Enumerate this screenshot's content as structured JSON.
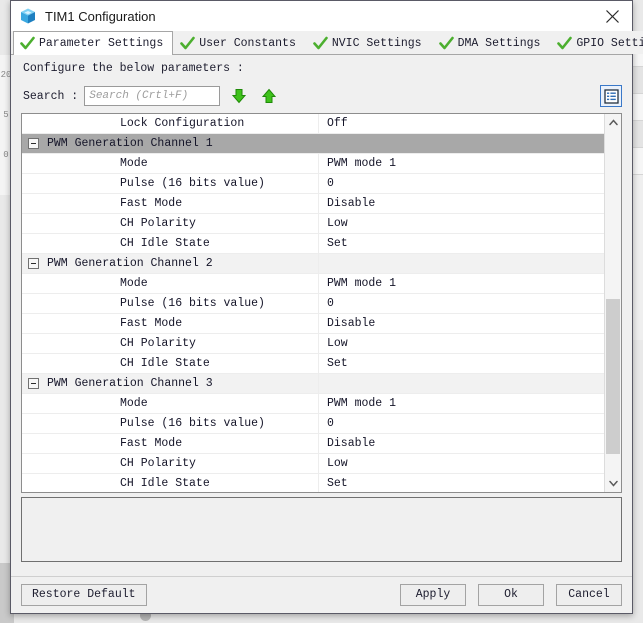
{
  "window": {
    "title": "TIM1 Configuration",
    "icon": "cube-icon",
    "close_label": "✕",
    "accent": "#3a78c8",
    "selected_row_color": "#a8a8a8",
    "check_color": "#4caf2f"
  },
  "tabs": [
    {
      "label": "Parameter Settings",
      "icon": "green-check-icon",
      "active": true
    },
    {
      "label": "User Constants",
      "icon": "green-check-icon",
      "active": false
    },
    {
      "label": "NVIC Settings",
      "icon": "green-check-icon",
      "active": false
    },
    {
      "label": "DMA Settings",
      "icon": "green-check-icon",
      "active": false
    },
    {
      "label": "GPIO Settings",
      "icon": "green-check-icon",
      "active": false
    }
  ],
  "instruction": "Configure the below parameters :",
  "search": {
    "label": "Search :",
    "value": "",
    "placeholder": "Search (Crtl+F)",
    "next_icon": "arrow-down-icon",
    "prev_icon": "arrow-up-icon",
    "view_toggle_icon": "list-view-icon"
  },
  "table": {
    "rows": [
      {
        "type": "param",
        "name": "Lock Configuration",
        "value": "Off"
      },
      {
        "type": "group",
        "name": "PWM Generation Channel 1",
        "value": "",
        "selected": true
      },
      {
        "type": "param",
        "name": "Mode",
        "value": "PWM mode 1"
      },
      {
        "type": "param",
        "name": "Pulse (16 bits value)",
        "value": "0"
      },
      {
        "type": "param",
        "name": "Fast Mode",
        "value": "Disable"
      },
      {
        "type": "param",
        "name": "CH Polarity",
        "value": "Low"
      },
      {
        "type": "param",
        "name": "CH Idle State",
        "value": "Set"
      },
      {
        "type": "group",
        "name": "PWM Generation Channel 2",
        "value": "",
        "selected": false
      },
      {
        "type": "param",
        "name": "Mode",
        "value": "PWM mode 1"
      },
      {
        "type": "param",
        "name": "Pulse (16 bits value)",
        "value": "0"
      },
      {
        "type": "param",
        "name": "Fast Mode",
        "value": "Disable"
      },
      {
        "type": "param",
        "name": "CH Polarity",
        "value": "Low"
      },
      {
        "type": "param",
        "name": "CH Idle State",
        "value": "Set"
      },
      {
        "type": "group",
        "name": "PWM Generation Channel 3",
        "value": "",
        "selected": false
      },
      {
        "type": "param",
        "name": "Mode",
        "value": "PWM mode 1"
      },
      {
        "type": "param",
        "name": "Pulse (16 bits value)",
        "value": "0"
      },
      {
        "type": "param",
        "name": "Fast Mode",
        "value": "Disable"
      },
      {
        "type": "param",
        "name": "CH Polarity",
        "value": "Low"
      },
      {
        "type": "param",
        "name": "CH Idle State",
        "value": "Set"
      }
    ],
    "scrollbar": {
      "up_icon": "chevron-up-icon",
      "down_icon": "chevron-down-icon"
    }
  },
  "description": {
    "text": ""
  },
  "footer": {
    "restore": "Restore Default",
    "apply": "Apply",
    "ok": "Ok",
    "cancel": "Cancel"
  }
}
